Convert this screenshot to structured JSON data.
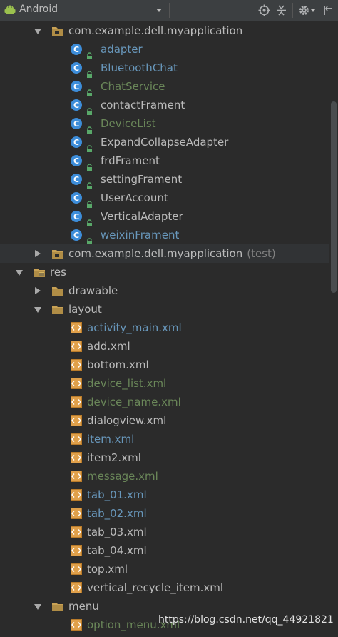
{
  "toolbar": {
    "title": "Android"
  },
  "tree": [
    {
      "label": "com.example.dell.myapplication",
      "kind": "package",
      "expanded": true,
      "level": 1,
      "color": "default"
    },
    {
      "label": "adapter",
      "kind": "class",
      "level": 2,
      "color": "blue"
    },
    {
      "label": "BluetoothChat",
      "kind": "class",
      "level": 2,
      "color": "blue"
    },
    {
      "label": "ChatService",
      "kind": "class",
      "level": 2,
      "color": "green"
    },
    {
      "label": "contactFrament",
      "kind": "class",
      "level": 2,
      "color": "default"
    },
    {
      "label": "DeviceList",
      "kind": "class",
      "level": 2,
      "color": "green"
    },
    {
      "label": "ExpandCollapseAdapter",
      "kind": "class",
      "level": 2,
      "color": "default"
    },
    {
      "label": "frdFrament",
      "kind": "class",
      "level": 2,
      "color": "default"
    },
    {
      "label": "settingFrament",
      "kind": "class",
      "level": 2,
      "color": "default"
    },
    {
      "label": "UserAccount",
      "kind": "class",
      "level": 2,
      "color": "default"
    },
    {
      "label": "VerticalAdapter",
      "kind": "class",
      "level": 2,
      "color": "default"
    },
    {
      "label": "weixinFrament",
      "kind": "class",
      "level": 2,
      "color": "blue"
    },
    {
      "label": "com.example.dell.myapplication",
      "suffix": "(test)",
      "kind": "package",
      "expanded": false,
      "level": 1,
      "color": "default"
    },
    {
      "label": "res",
      "kind": "res",
      "expanded": true,
      "level": 0,
      "color": "default"
    },
    {
      "label": "drawable",
      "kind": "folder",
      "expanded": false,
      "level": 1,
      "color": "default"
    },
    {
      "label": "layout",
      "kind": "folder",
      "expanded": true,
      "level": 1,
      "color": "default"
    },
    {
      "label": "activity_main.xml",
      "kind": "xml",
      "level": 2,
      "color": "blue"
    },
    {
      "label": "add.xml",
      "kind": "xml",
      "level": 2,
      "color": "default"
    },
    {
      "label": "bottom.xml",
      "kind": "xml",
      "level": 2,
      "color": "default"
    },
    {
      "label": "device_list.xml",
      "kind": "xml",
      "level": 2,
      "color": "green"
    },
    {
      "label": "device_name.xml",
      "kind": "xml",
      "level": 2,
      "color": "green"
    },
    {
      "label": "dialogview.xml",
      "kind": "xml",
      "level": 2,
      "color": "default"
    },
    {
      "label": "item.xml",
      "kind": "xml",
      "level": 2,
      "color": "blue"
    },
    {
      "label": "item2.xml",
      "kind": "xml",
      "level": 2,
      "color": "default"
    },
    {
      "label": "message.xml",
      "kind": "xml",
      "level": 2,
      "color": "green"
    },
    {
      "label": "tab_01.xml",
      "kind": "xml",
      "level": 2,
      "color": "blue"
    },
    {
      "label": "tab_02.xml",
      "kind": "xml",
      "level": 2,
      "color": "blue"
    },
    {
      "label": "tab_03.xml",
      "kind": "xml",
      "level": 2,
      "color": "default"
    },
    {
      "label": "tab_04.xml",
      "kind": "xml",
      "level": 2,
      "color": "default"
    },
    {
      "label": "top.xml",
      "kind": "xml",
      "level": 2,
      "color": "default"
    },
    {
      "label": "vertical_recycle_item.xml",
      "kind": "xml",
      "level": 2,
      "color": "default"
    },
    {
      "label": "menu",
      "kind": "folder",
      "expanded": true,
      "level": 1,
      "color": "default"
    },
    {
      "label": "option_menu.xml",
      "kind": "xml",
      "level": 2,
      "color": "green"
    }
  ],
  "watermark": "https://blog.csdn.net/qq_44921821",
  "colors": {
    "background": "#2b2b2b",
    "text_default": "#bbbbbb",
    "text_blue": "#6897bb",
    "text_green": "#6a8759",
    "class_icon": "#3d8dd9",
    "lock_green": "#59a869",
    "folder": "#c9a255",
    "xml_icon": "#e0a04a"
  }
}
